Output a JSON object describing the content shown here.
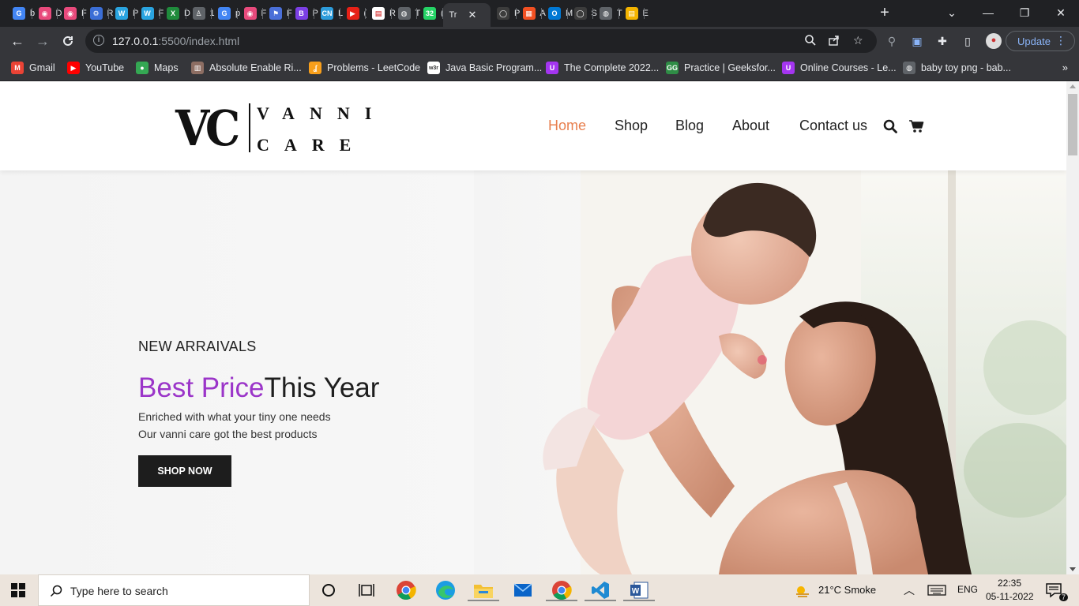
{
  "browser": {
    "tabs": [
      {
        "letter": "b",
        "color": "#4285f4",
        "glyph": "G"
      },
      {
        "letter": "D",
        "color": "#e84a7c",
        "glyph": "◉"
      },
      {
        "letter": "F",
        "color": "#e84a7c",
        "glyph": "◉"
      },
      {
        "letter": "R",
        "color": "#3b6ed6",
        "glyph": "⚙"
      },
      {
        "letter": "P",
        "color": "#2aa4e0",
        "glyph": "W"
      },
      {
        "letter": "F",
        "color": "#2aa4e0",
        "glyph": "W"
      },
      {
        "letter": "D",
        "color": "#1f8b3c",
        "glyph": "X"
      },
      {
        "letter": "1",
        "color": "#5f6368",
        "glyph": "♙"
      },
      {
        "letter": "p",
        "color": "#4285f4",
        "glyph": "G"
      },
      {
        "letter": "F",
        "color": "#e84a7c",
        "glyph": "◉"
      },
      {
        "letter": "F",
        "color": "#4a6fd8",
        "glyph": "⚑"
      },
      {
        "letter": "P",
        "color": "#7b3fe4",
        "glyph": "B"
      },
      {
        "letter": "L",
        "color": "#2d9cdb",
        "glyph": "CN"
      },
      {
        "letter": "(",
        "color": "#e62117",
        "glyph": "▶"
      },
      {
        "letter": "R",
        "color": "#ffffff",
        "glyph": "▤"
      },
      {
        "letter": "T",
        "color": "#5f6368",
        "glyph": "◍"
      },
      {
        "letter": "(",
        "color": "#25d366",
        "glyph": "32"
      },
      {
        "letter": "Tr",
        "color": "#35363a",
        "glyph": ""
      },
      {
        "letter": "P",
        "color": "#3c3c3c",
        "glyph": "◯"
      },
      {
        "letter": "A",
        "color": "#f25022",
        "glyph": "▦"
      },
      {
        "letter": "M",
        "color": "#0078d4",
        "glyph": "O"
      },
      {
        "letter": "S",
        "color": "#3c3c3c",
        "glyph": "◯"
      },
      {
        "letter": "T",
        "color": "#5f6368",
        "glyph": "◍"
      },
      {
        "letter": "E",
        "color": "#f4b400",
        "glyph": "▤"
      }
    ],
    "url_host": "127.0.0.1",
    "url_path": ":5500/index.html",
    "update_label": "Update",
    "bookmarks": [
      {
        "label": "Gmail",
        "icon": "gmail-icon",
        "color": "#ea4335",
        "glyph": "M"
      },
      {
        "label": "YouTube",
        "icon": "youtube-icon",
        "color": "#ff0000",
        "glyph": "▶"
      },
      {
        "label": "Maps",
        "icon": "maps-icon",
        "color": "#34a853",
        "glyph": "●"
      },
      {
        "label": "Absolute Enable Ri...",
        "icon": "extension-icon",
        "color": "#8d6e63",
        "glyph": "▥"
      },
      {
        "label": "Problems - LeetCode",
        "icon": "leetcode-icon",
        "color": "#f89f1b",
        "glyph": "ʆ"
      },
      {
        "label": "Java Basic Program...",
        "icon": "w3r-icon",
        "color": "#ffffff",
        "glyph": "w3r"
      },
      {
        "label": "The Complete 2022...",
        "icon": "udemy-icon",
        "color": "#a435f0",
        "glyph": "U"
      },
      {
        "label": "Practice | Geeksfor...",
        "icon": "gfg-icon",
        "color": "#2f8d46",
        "glyph": "GG"
      },
      {
        "label": "Online Courses - Le...",
        "icon": "udemy-icon",
        "color": "#a435f0",
        "glyph": "U"
      },
      {
        "label": "baby toy png - bab...",
        "icon": "globe-icon",
        "color": "#5f6368",
        "glyph": "◍"
      }
    ]
  },
  "site": {
    "logo_mono": "VC",
    "logo_word1": "VANNI",
    "logo_word2": "CARE",
    "nav": [
      "Home",
      "Shop",
      "Blog",
      "About",
      "Contact us"
    ],
    "active_nav": "Home",
    "accent_color": "#9b35c9",
    "nav_active_color": "#e8804f",
    "hero": {
      "eyebrow": "NEW ARRAIVALS",
      "headline_accent": "Best Price",
      "headline_rest": "This Year",
      "line1": "Enriched with what your tiny one needs",
      "line2": "Our vanni care got the best products",
      "button": "SHOP NOW"
    }
  },
  "taskbar": {
    "search_placeholder": "Type here to search",
    "weather": "21°C  Smoke",
    "lang": "ENG",
    "time": "22:35",
    "date": "05-11-2022",
    "notifications": "7"
  }
}
